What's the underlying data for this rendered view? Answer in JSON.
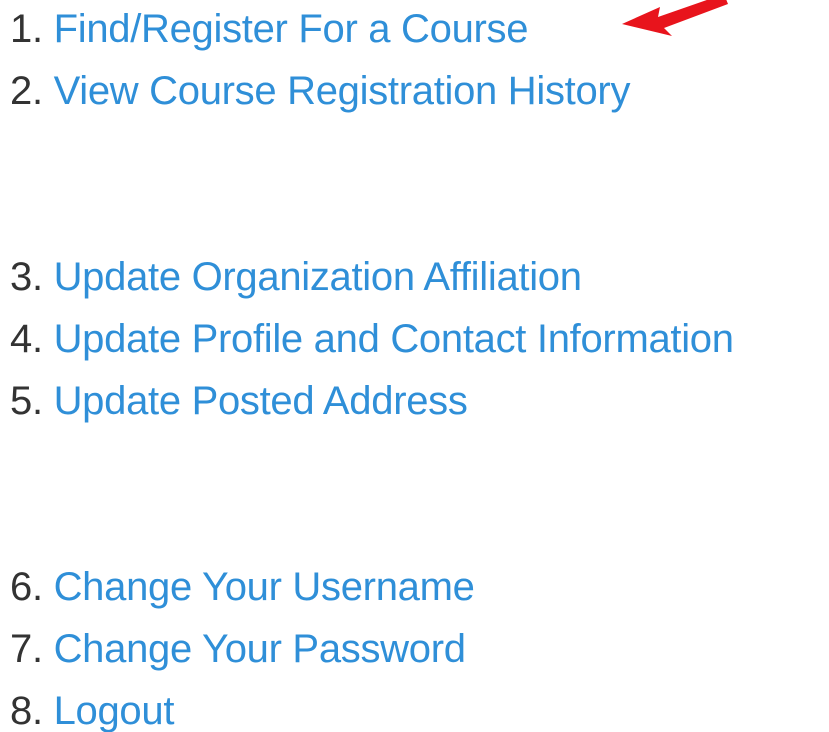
{
  "menu": {
    "items": [
      {
        "number": "1.",
        "label": "Find/Register For a Course"
      },
      {
        "number": "2.",
        "label": "View Course Registration History"
      },
      {
        "number": "3.",
        "label": "Update Organization Affiliation"
      },
      {
        "number": "4.",
        "label": "Update Profile and Contact Information"
      },
      {
        "number": "5.",
        "label": "Update Posted Address"
      },
      {
        "number": "6.",
        "label": "Change Your Username"
      },
      {
        "number": "7.",
        "label": "Change Your Password"
      },
      {
        "number": "8.",
        "label": "Logout"
      }
    ]
  },
  "colors": {
    "link": "#2f8fd8",
    "number": "#333333",
    "arrow": "#e8141c",
    "background": "#ffffff"
  },
  "annotation": {
    "icon": "red-arrow-icon"
  }
}
